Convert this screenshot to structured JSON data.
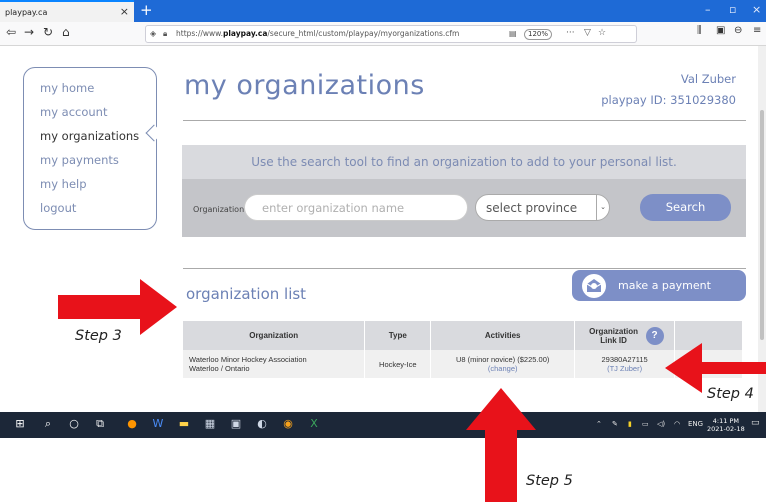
{
  "browser": {
    "tab_title": "playpay.ca",
    "url_prefix": "https://www.",
    "url_domain": "playpay.ca",
    "url_path": "/secure_html/custom/playpay/myorganizations.cfm",
    "zoom": "120%"
  },
  "sidebar": {
    "items": [
      {
        "label": "my home"
      },
      {
        "label": "my account"
      },
      {
        "label": "my organizations"
      },
      {
        "label": "my payments"
      },
      {
        "label": "my help"
      },
      {
        "label": "logout"
      }
    ],
    "active_index": 2
  },
  "header": {
    "title": "my organizations",
    "user_name": "Val Zuber",
    "user_id": "playpay ID: 351029380"
  },
  "search": {
    "hint": "Use the search tool to find an organization to add to your personal list.",
    "org_label": "Organization",
    "org_placeholder": "enter organization name",
    "province_value": "select province",
    "button_label": "Search"
  },
  "payment_button": {
    "label": "make a payment"
  },
  "org_list": {
    "title": "organization list",
    "columns": [
      "Organization",
      "Type",
      "Activities",
      "Organization Link ID",
      ""
    ],
    "help_icon": "?",
    "rows": [
      {
        "org_name": "Waterloo Minor Hockey Association",
        "org_location": "Waterloo / Ontario",
        "type": "Hockey-Ice",
        "activity": "U8 (minor novice) ($225.00)",
        "change_link": "(change)",
        "link_id": "29380A27115",
        "link_person": "(TJ Zuber)"
      }
    ]
  },
  "annotations": {
    "step3": "Step 3",
    "step4": "Step 4",
    "step5": "Step 5",
    "arrow_color": "#e8121a"
  },
  "taskbar": {
    "language": "ENG",
    "time": "4:11 PM",
    "date": "2021-02-18"
  },
  "colors": {
    "accent": "#6c81b5",
    "button": "#7d8fc7",
    "taskbar": "#1c2738",
    "browser_tabbar": "#1e6ad6"
  }
}
